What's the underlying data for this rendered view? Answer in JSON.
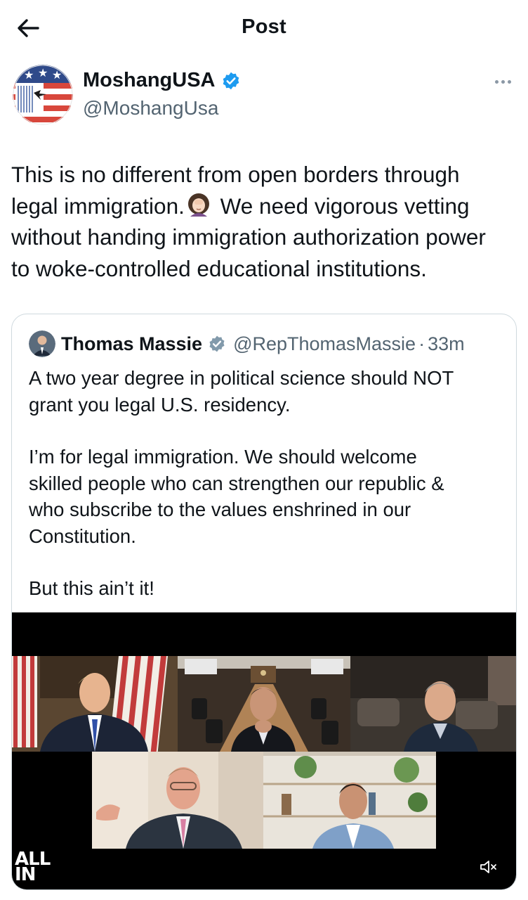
{
  "header": {
    "title": "Post",
    "back_icon": "arrow-left-icon"
  },
  "author": {
    "name": "MoshangUSA",
    "handle": "@MoshangUsa",
    "verified_icon": "verified-badge-icon",
    "verified_color": "#1d9bf0",
    "more_icon": "more-horizontal-icon"
  },
  "post": {
    "lines": [
      "This is no different from open borders through",
      "legal immigration.",
      "We need vigorous vetting",
      "without handing immigration authorization power",
      "to woke-controlled educational institutions."
    ],
    "emoji_icon": "woman-facepalming-emoji"
  },
  "quote": {
    "name": "Thomas Massie",
    "handle": "@RepThomasMassie",
    "separator": "·",
    "time": "33m",
    "verified_icon": "verified-gray-badge-icon",
    "paragraphs": [
      [
        "A two year degree in political science should NOT",
        "grant you legal U.S. residency."
      ],
      [
        "I’m for legal immigration. We should welcome",
        "skilled people who can strengthen our republic &",
        "who subscribe to the values enshrined in our",
        "Constitution."
      ],
      [
        "But this ain’t it!"
      ]
    ]
  },
  "video": {
    "logo_line1": "ALL",
    "logo_line2": "IN",
    "mute_icon": "speaker-muted-icon",
    "tiles": [
      "video-tile-oval-office",
      "video-tile-conference-room",
      "video-tile-living-room",
      "video-tile-office-speaker",
      "video-tile-bookshelf"
    ]
  },
  "colors": {
    "text_primary": "#0f1419",
    "text_secondary": "#536471",
    "border": "#cfd9de",
    "accent": "#1d9bf0"
  }
}
